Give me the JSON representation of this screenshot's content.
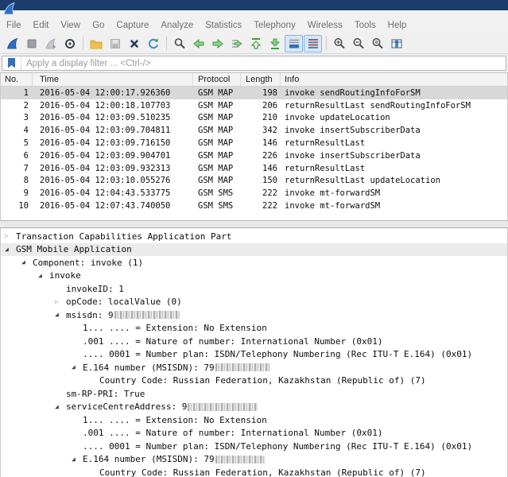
{
  "window": {
    "app": "Wireshark",
    "title": ""
  },
  "menu": {
    "items": [
      "File",
      "Edit",
      "View",
      "Go",
      "Capture",
      "Analyze",
      "Statistics",
      "Telephony",
      "Wireless",
      "Tools",
      "Help"
    ]
  },
  "toolbar": {
    "items": [
      {
        "icon": "start-capture-fin-icon",
        "pressed": false
      },
      {
        "icon": "stop-capture-icon",
        "pressed": false
      },
      {
        "icon": "restart-capture-fin-icon",
        "pressed": false
      },
      {
        "icon": "capture-options-icon",
        "pressed": false
      },
      {
        "sep": true
      },
      {
        "icon": "open-file-folder-icon",
        "pressed": false
      },
      {
        "icon": "save-file-icon",
        "pressed": false
      },
      {
        "icon": "close-file-icon",
        "pressed": false
      },
      {
        "icon": "reload-file-icon",
        "pressed": false
      },
      {
        "sep": true
      },
      {
        "icon": "find-packet-icon",
        "pressed": false
      },
      {
        "icon": "go-back-icon",
        "pressed": false
      },
      {
        "icon": "go-forward-icon",
        "pressed": false
      },
      {
        "icon": "go-to-packet-icon",
        "pressed": false
      },
      {
        "icon": "go-to-top-icon",
        "pressed": false
      },
      {
        "icon": "go-to-bottom-icon",
        "pressed": false
      },
      {
        "icon": "auto-scroll-icon",
        "pressed": true
      },
      {
        "icon": "colorize-packets-icon",
        "pressed": true
      },
      {
        "sep": true
      },
      {
        "icon": "zoom-in-icon",
        "pressed": false
      },
      {
        "icon": "zoom-out-icon",
        "pressed": false
      },
      {
        "icon": "zoom-reset-icon",
        "pressed": false
      },
      {
        "icon": "resize-columns-icon",
        "pressed": false
      }
    ]
  },
  "filter": {
    "placeholder": "Apply a display filter ... <Ctrl-/>",
    "bookmark_color": "#3a6fb5"
  },
  "packet_list": {
    "columns": [
      "No.",
      "Time",
      "Protocol",
      "Length",
      "Info"
    ],
    "rows": [
      {
        "no": "1",
        "time": "2016-05-04 12:00:17.926360",
        "protocol": "GSM MAP",
        "length": "198",
        "info": "invoke sendRoutingInfoForSM",
        "selected": true
      },
      {
        "no": "2",
        "time": "2016-05-04 12:00:18.107703",
        "protocol": "GSM MAP",
        "length": "206",
        "info": "returnResultLast sendRoutingInfoForSM",
        "selected": false
      },
      {
        "no": "3",
        "time": "2016-05-04 12:03:09.510235",
        "protocol": "GSM MAP",
        "length": "210",
        "info": "invoke updateLocation",
        "selected": false
      },
      {
        "no": "4",
        "time": "2016-05-04 12:03:09.704811",
        "protocol": "GSM MAP",
        "length": "342",
        "info": "invoke insertSubscriberData",
        "selected": false
      },
      {
        "no": "5",
        "time": "2016-05-04 12:03:09.716150",
        "protocol": "GSM MAP",
        "length": "146",
        "info": "returnResultLast",
        "selected": false
      },
      {
        "no": "6",
        "time": "2016-05-04 12:03:09.904701",
        "protocol": "GSM MAP",
        "length": "226",
        "info": "invoke insertSubscriberData",
        "selected": false
      },
      {
        "no": "7",
        "time": "2016-05-04 12:03:09.932313",
        "protocol": "GSM MAP",
        "length": "146",
        "info": "returnResultLast",
        "selected": false
      },
      {
        "no": "8",
        "time": "2016-05-04 12:03:10.055276",
        "protocol": "GSM MAP",
        "length": "150",
        "info": "returnResultLast updateLocation",
        "selected": false
      },
      {
        "no": "9",
        "time": "2016-05-04 12:04:43.533775",
        "protocol": "GSM SMS",
        "length": "222",
        "info": "invoke mt-forwardSM",
        "selected": false
      },
      {
        "no": "10",
        "time": "2016-05-04 12:07:43.740050",
        "protocol": "GSM SMS",
        "length": "222",
        "info": "invoke mt-forwardSM",
        "selected": false
      }
    ]
  },
  "details": {
    "lines": [
      {
        "level": 0,
        "expand": "collapsed",
        "text": "Transaction Capabilities Application Part",
        "selected": false
      },
      {
        "level": 0,
        "expand": "expanded",
        "text": "GSM Mobile Application",
        "selected": true
      },
      {
        "level": 1,
        "expand": "expanded",
        "text": "Component: invoke (1)",
        "selected": false
      },
      {
        "level": 2,
        "expand": "expanded",
        "text": "invoke",
        "selected": false
      },
      {
        "level": 3,
        "expand": "none",
        "text": "invokeID: 1",
        "selected": false
      },
      {
        "level": 3,
        "expand": "collapsed",
        "text": "opCode: localValue (0)",
        "selected": false
      },
      {
        "level": 3,
        "expand": "expanded",
        "text": "msisdn: 9",
        "redacted": true,
        "mask_len": 13,
        "selected": false
      },
      {
        "level": 4,
        "expand": "none",
        "text": "1... .... = Extension: No Extension",
        "selected": false
      },
      {
        "level": 4,
        "expand": "none",
        "text": ".001 .... = Nature of number: International Number (0x01)",
        "selected": false
      },
      {
        "level": 4,
        "expand": "none",
        "text": ".... 0001 = Number plan: ISDN/Telephony Numbering (Rec ITU-T E.164) (0x01)",
        "selected": false
      },
      {
        "level": 4,
        "expand": "expanded",
        "text": "E.164 number (MSISDN): 79",
        "redacted": true,
        "mask_len": 11,
        "selected": false
      },
      {
        "level": 5,
        "expand": "none",
        "text": "Country Code: Russian Federation, Kazakhstan (Republic of) (7)",
        "selected": false
      },
      {
        "level": 3,
        "expand": "none",
        "text": "sm-RP-PRI: True",
        "selected": false
      },
      {
        "level": 3,
        "expand": "expanded",
        "text": "serviceCentreAddress: 9",
        "redacted": true,
        "mask_len": 14,
        "selected": false
      },
      {
        "level": 4,
        "expand": "none",
        "text": "1... .... = Extension: No Extension",
        "selected": false
      },
      {
        "level": 4,
        "expand": "none",
        "text": ".001 .... = Nature of number: International Number (0x01)",
        "selected": false
      },
      {
        "level": 4,
        "expand": "none",
        "text": ".... 0001 = Number plan: ISDN/Telephony Numbering (Rec ITU-T E.164) (0x01)",
        "selected": false
      },
      {
        "level": 4,
        "expand": "expanded",
        "text": "E.164 number (MSISDN): 79",
        "redacted": true,
        "mask_len": 10,
        "selected": false
      },
      {
        "level": 5,
        "expand": "none",
        "text": "Country Code: Russian Federation, Kazakhstan (Republic of) (7)",
        "selected": false
      }
    ]
  },
  "colors": {
    "titlebar": "#1b3d6d",
    "selection_gray": "#d8d8d8",
    "pressed_button_bg": "#d6e7f8",
    "pressed_button_border": "#8ab4e8",
    "fin_blue": "#2e6fc9"
  }
}
